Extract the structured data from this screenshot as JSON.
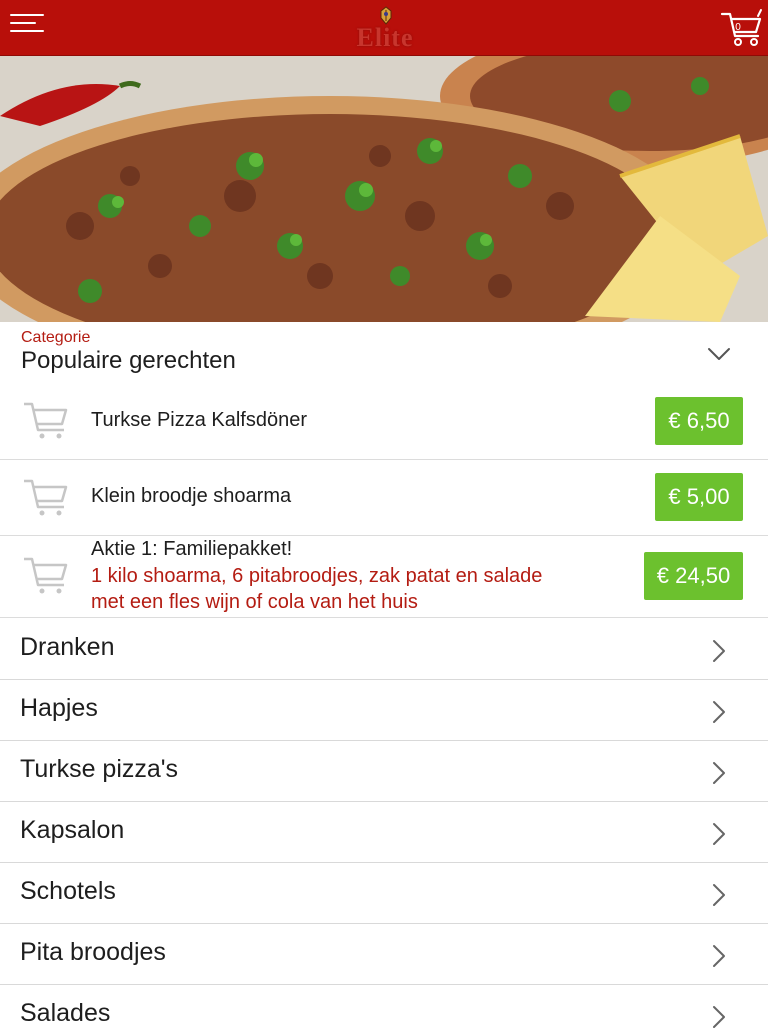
{
  "header": {
    "logo_text": "Elite",
    "cart_count": "0",
    "brand_color": "#b80f0a"
  },
  "hero": {
    "image_alt": ""
  },
  "category_section": {
    "kicker": "Categorie",
    "title": "Populaire gerechten"
  },
  "dishes": [
    {
      "name": "Turkse Pizza Kalfsdöner",
      "description": "",
      "price": "€ 6,50"
    },
    {
      "name": "Klein broodje shoarma",
      "description": "",
      "price": "€ 5,00"
    },
    {
      "name": "Aktie 1: Familiepakket!",
      "description_line1": "1 kilo shoarma, 6 pitabroodjes, zak patat en salade",
      "description_line2": "met een fles wijn of cola van het huis",
      "price": "€ 24,50"
    }
  ],
  "categories": [
    {
      "label": "Dranken"
    },
    {
      "label": "Hapjes"
    },
    {
      "label": "Turkse pizza's"
    },
    {
      "label": "Kapsalon"
    },
    {
      "label": "Schotels"
    },
    {
      "label": "Pita broodjes"
    },
    {
      "label": "Salades"
    }
  ],
  "colors": {
    "price_green": "#6cc12e",
    "accent_red": "#b41c12"
  },
  "icons": {
    "menu": "hamburger-menu-icon",
    "cart": "shopping-cart-icon",
    "category_toggle": "chevron-down-icon",
    "category_arrow": "chevron-right-icon"
  }
}
